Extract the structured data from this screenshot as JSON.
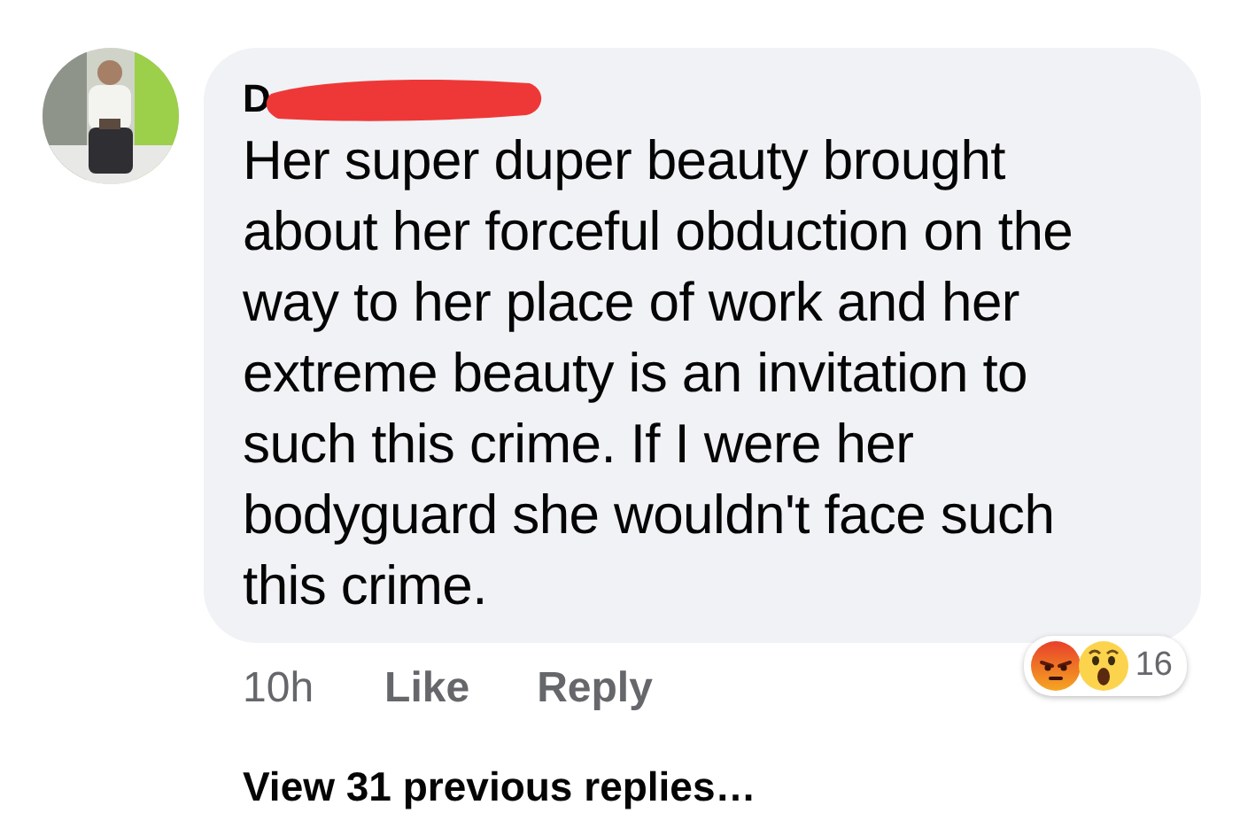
{
  "comment": {
    "author": "D",
    "redacted": true,
    "text": "Her super duper beauty brought about her forceful obduction on the way to her place of work and her extreme beauty is an invitation to such this crime. If I were her bodyguard she wouldn't face such this crime.",
    "time": "10h",
    "actions": [
      "Like",
      "Reply"
    ],
    "reactions": {
      "types": [
        {
          "kind": "angry"
        },
        {
          "kind": "wow"
        }
      ],
      "count": "16"
    }
  },
  "view_replies": "View 31 previous replies…"
}
